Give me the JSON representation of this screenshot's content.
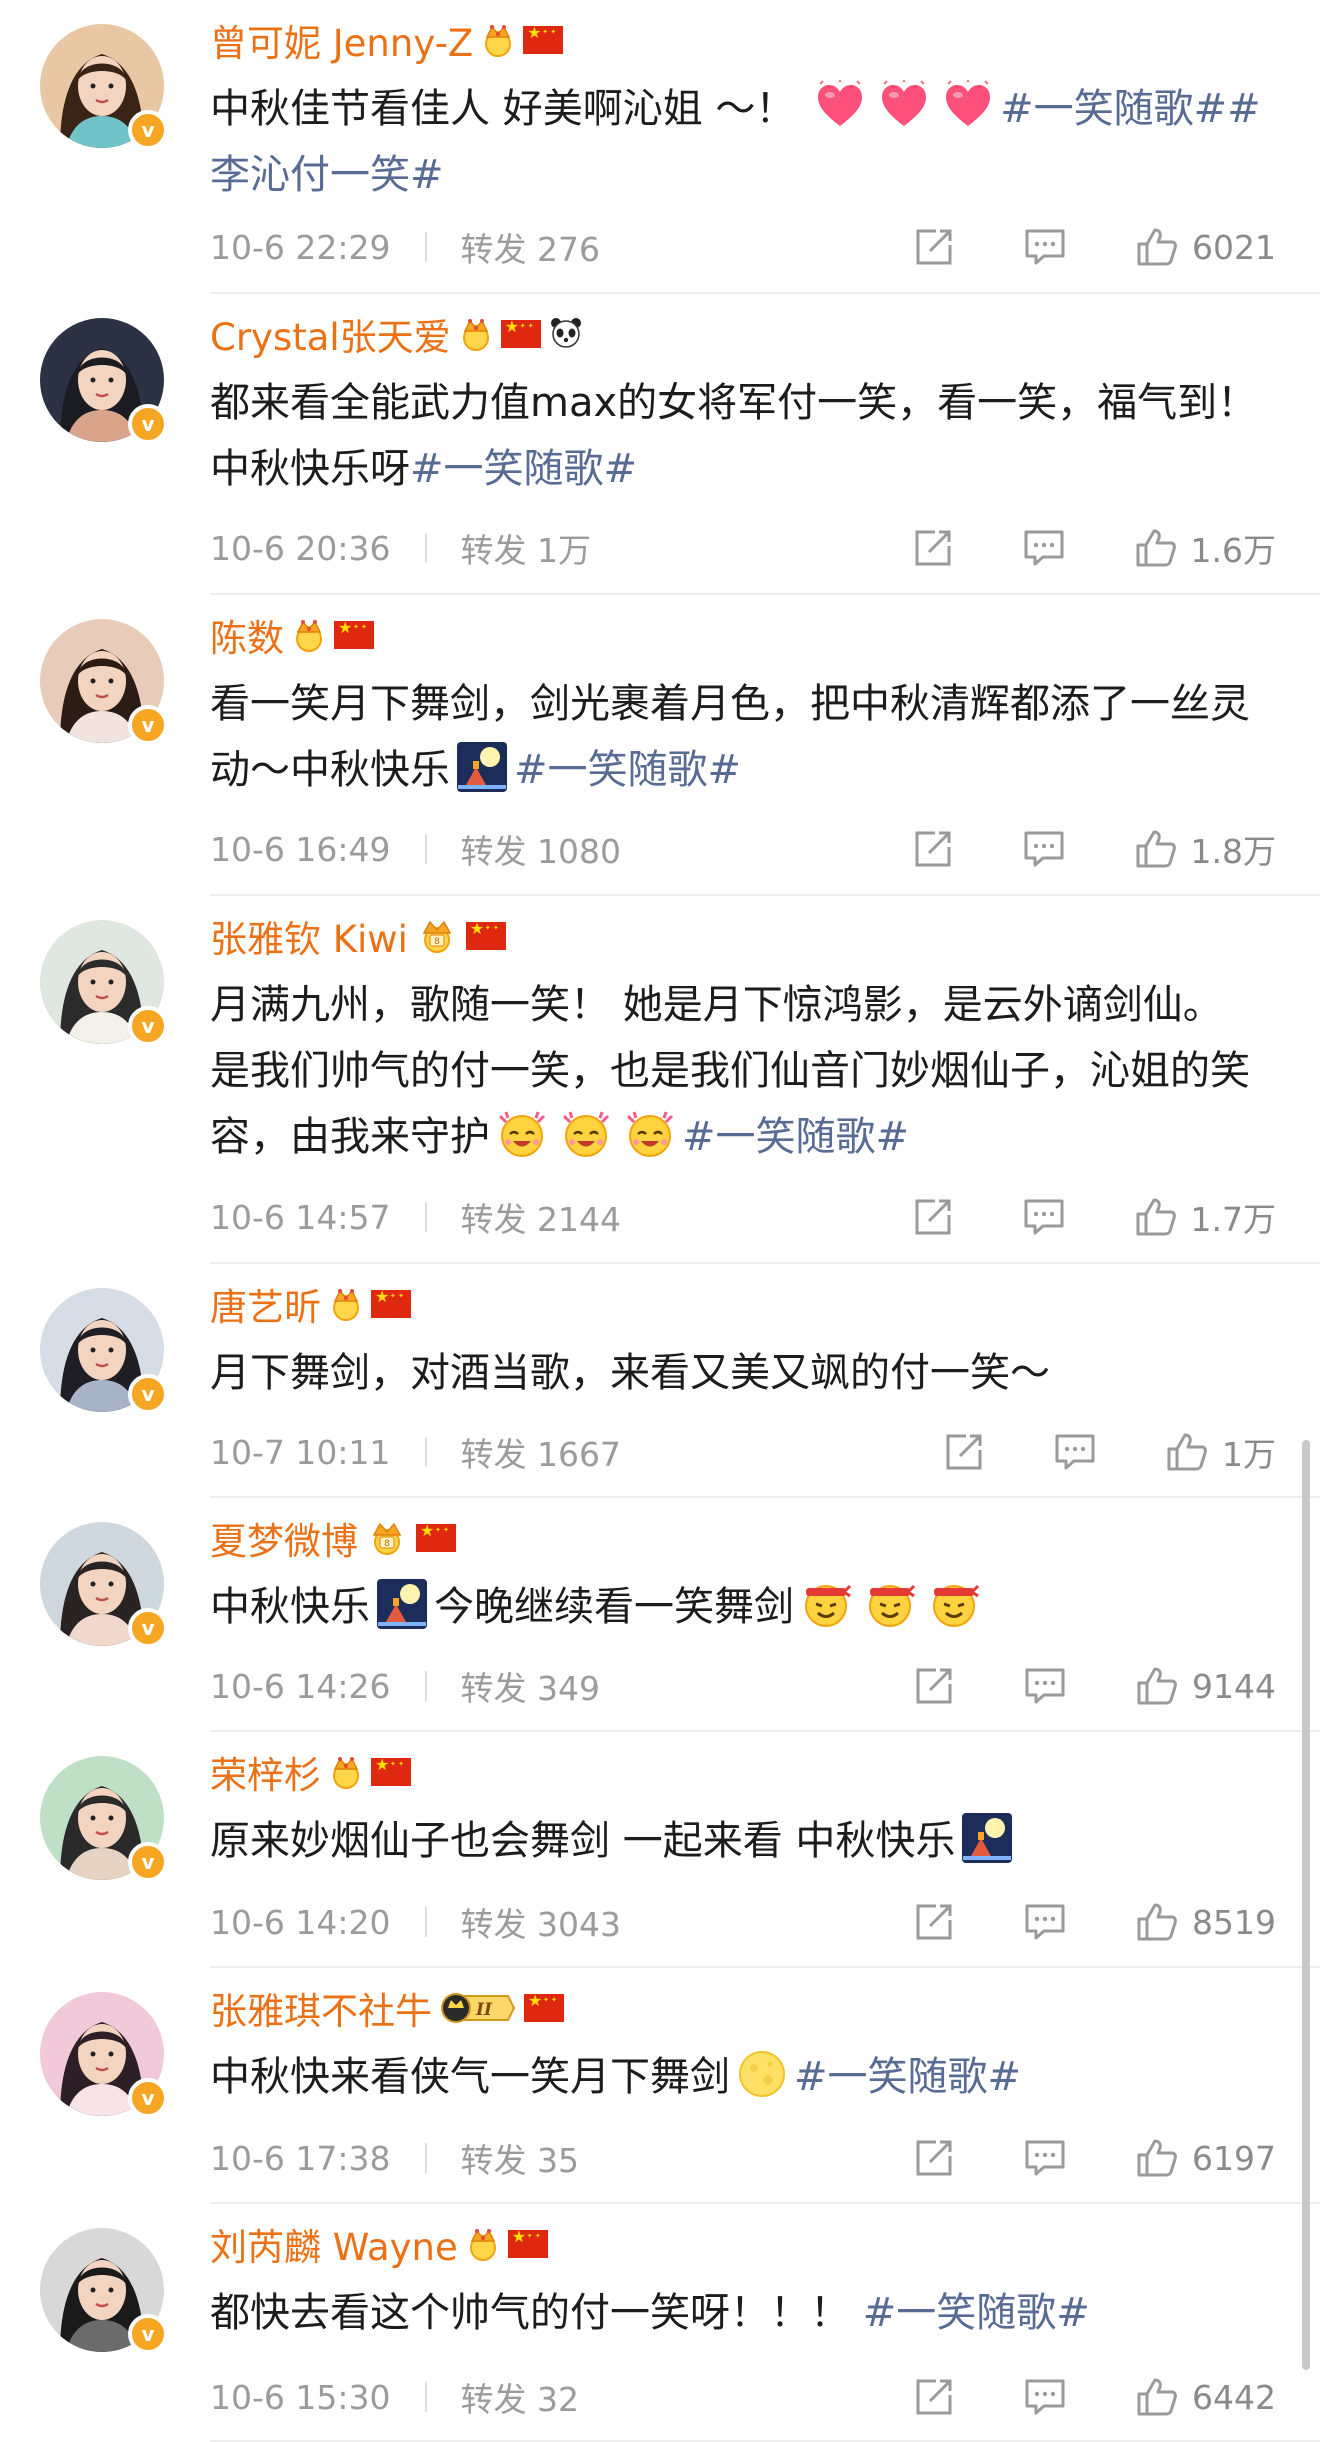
{
  "colors": {
    "name": "#eb7117",
    "hashtag": "#576b95",
    "meta": "#9b9b9b",
    "badge": "#f6a623"
  },
  "labels": {
    "repost": "转发"
  },
  "comments": [
    {
      "name": "曾可妮 Jenny-Z",
      "badges": [
        "crown-icon",
        "china-flag-icon"
      ],
      "segments": [
        {
          "t": "text",
          "v": "中秋佳节看佳人 好美啊沁姐 ～！ "
        },
        {
          "t": "emoji",
          "v": "heart-emoji"
        },
        {
          "t": "emoji",
          "v": "heart-emoji"
        },
        {
          "t": "emoji",
          "v": "heart-emoji"
        },
        {
          "t": "tag",
          "v": "#一笑随歌##李沁付一笑#"
        }
      ],
      "time": "10-6 22:29",
      "repost_count": "276",
      "likes": "6021"
    },
    {
      "name": "Crystal张天爱",
      "badges": [
        "crown-icon",
        "china-flag-icon",
        "panda-icon"
      ],
      "segments": [
        {
          "t": "text",
          "v": "都来看全能武力值max的女将军付一笑，看一笑，福气到！中秋快乐呀"
        },
        {
          "t": "tag",
          "v": "#一笑随歌#"
        }
      ],
      "time": "10-6 20:36",
      "repost_count": "1万",
      "likes": "1.6万"
    },
    {
      "name": "陈数",
      "badges": [
        "crown-icon",
        "china-flag-icon"
      ],
      "segments": [
        {
          "t": "text",
          "v": "看一笑月下舞剑，剑光裹着月色，把中秋清辉都添了一丝灵动～中秋快乐"
        },
        {
          "t": "emoji",
          "v": "moon-festival-emoji"
        },
        {
          "t": "tag",
          "v": "#一笑随歌#"
        }
      ],
      "time": "10-6 16:49",
      "repost_count": "1080",
      "likes": "1.8万"
    },
    {
      "name": "张雅钦 Kiwi",
      "badges": [
        "crown-level-icon",
        "china-flag-icon"
      ],
      "segments": [
        {
          "t": "text",
          "v": "月满九州，歌随一笑！ 她是月下惊鸿影，是云外谪剑仙。 是我们帅气的付一笑，也是我们仙音门妙烟仙子，沁姐的笑容，由我来守护"
        },
        {
          "t": "emoji",
          "v": "cheer-emoji"
        },
        {
          "t": "emoji",
          "v": "cheer-emoji"
        },
        {
          "t": "emoji",
          "v": "cheer-emoji"
        },
        {
          "t": "tag",
          "v": "#一笑随歌#"
        }
      ],
      "time": "10-6 14:57",
      "repost_count": "2144",
      "likes": "1.7万"
    },
    {
      "name": "唐艺昕",
      "badges": [
        "crown-icon",
        "china-flag-icon"
      ],
      "segments": [
        {
          "t": "text",
          "v": "月下舞剑，对酒当歌，来看又美又飒的付一笑～"
        }
      ],
      "time": "10-7 10:11",
      "repost_count": "1667",
      "likes": "1万"
    },
    {
      "name": "夏梦微博",
      "badges": [
        "crown-level-icon",
        "china-flag-icon"
      ],
      "segments": [
        {
          "t": "text",
          "v": "中秋快乐"
        },
        {
          "t": "emoji",
          "v": "moon-festival-emoji"
        },
        {
          "t": "text",
          "v": "今晚继续看一笑舞剑"
        },
        {
          "t": "emoji",
          "v": "fighting-emoji"
        },
        {
          "t": "emoji",
          "v": "fighting-emoji"
        },
        {
          "t": "emoji",
          "v": "fighting-emoji"
        }
      ],
      "time": "10-6 14:26",
      "repost_count": "349",
      "likes": "9144"
    },
    {
      "name": "荣梓杉",
      "badges": [
        "crown-icon",
        "china-flag-icon"
      ],
      "segments": [
        {
          "t": "text",
          "v": "原来妙烟仙子也会舞剑 一起来看 中秋快乐"
        },
        {
          "t": "emoji",
          "v": "moon-festival-emoji"
        }
      ],
      "time": "10-6 14:20",
      "repost_count": "3043",
      "likes": "8519"
    },
    {
      "name": "张雅琪不社牛",
      "badges": [
        "level-2-badge",
        "china-flag-icon"
      ],
      "segments": [
        {
          "t": "text",
          "v": "中秋快来看侠气一笑月下舞剑"
        },
        {
          "t": "emoji",
          "v": "full-moon-emoji"
        },
        {
          "t": "tag",
          "v": "#一笑随歌#"
        }
      ],
      "time": "10-6 17:38",
      "repost_count": "35",
      "likes": "6197"
    },
    {
      "name": "刘芮麟 Wayne",
      "badges": [
        "crown-icon",
        "china-flag-icon"
      ],
      "segments": [
        {
          "t": "text",
          "v": "都快去看这个帅气的付一笑呀！！！ "
        },
        {
          "t": "tag",
          "v": "#一笑随歌#"
        }
      ],
      "time": "10-6 15:30",
      "repost_count": "32",
      "likes": "6442"
    }
  ]
}
